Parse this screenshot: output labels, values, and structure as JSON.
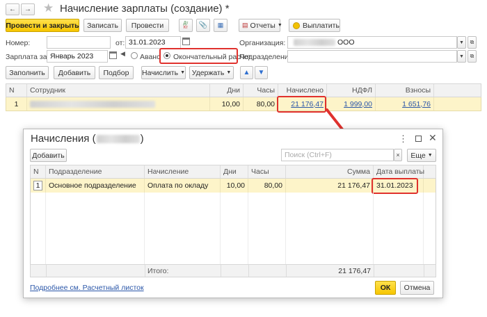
{
  "window": {
    "title": "Начисление зарплаты (создание) *"
  },
  "toolbar": {
    "post_close": "Провести и закрыть",
    "save": "Записать",
    "post": "Провести",
    "dt_kt": "Дт Кт",
    "reports": "Отчеты",
    "pay": "Выплатить"
  },
  "form": {
    "number_label": "Номер:",
    "number_value": "",
    "from_label": "от:",
    "date_value": "31.01.2023",
    "org_label": "Организация:",
    "org_value": "ООО",
    "period_label": "Зарплата за:",
    "period_value": "Январь 2023",
    "advance_label": "Аванс",
    "final_label": "Окончательный расчет",
    "division_label": "Подразделение:",
    "division_value": ""
  },
  "actions": {
    "fill": "Заполнить",
    "add": "Добавить",
    "select": "Подбор",
    "accrue": "Начислить",
    "withhold": "Удержать"
  },
  "main_table": {
    "columns": [
      "N",
      "Сотрудник",
      "Дни",
      "Часы",
      "Начислено",
      "НДФЛ",
      "Взносы"
    ],
    "rows": [
      {
        "n": "1",
        "employee": "",
        "days": "10,00",
        "hours": "80,00",
        "accrued": "21 176,47",
        "ndfl": "1 999,00",
        "contributions": "1 651,76"
      }
    ]
  },
  "dialog": {
    "title_prefix": "Начисления (",
    "title_suffix": ")",
    "add": "Добавить",
    "search_placeholder": "Поиск (Ctrl+F)",
    "more": "Еще",
    "columns": [
      "N",
      "Подразделение",
      "Начисление",
      "Дни",
      "Часы",
      "Сумма",
      "Дата выплаты"
    ],
    "rows": [
      {
        "n": "1",
        "division": "Основное подразделение",
        "accrual": "Оплата по окладу",
        "days": "10,00",
        "hours": "80,00",
        "sum": "21 176,47",
        "pay_date": "31.01.2023"
      }
    ],
    "footer_total_label": "Итого:",
    "footer_total_value": "21 176,47",
    "payslip_link": "Подробнее см. Расчетный листок",
    "ok": "ОК",
    "cancel": "Отмена"
  },
  "colors": {
    "accent": "#f7c600",
    "highlight_row": "#fdf4c9",
    "red_annotation": "#e0312d",
    "link": "#2a56a8"
  }
}
